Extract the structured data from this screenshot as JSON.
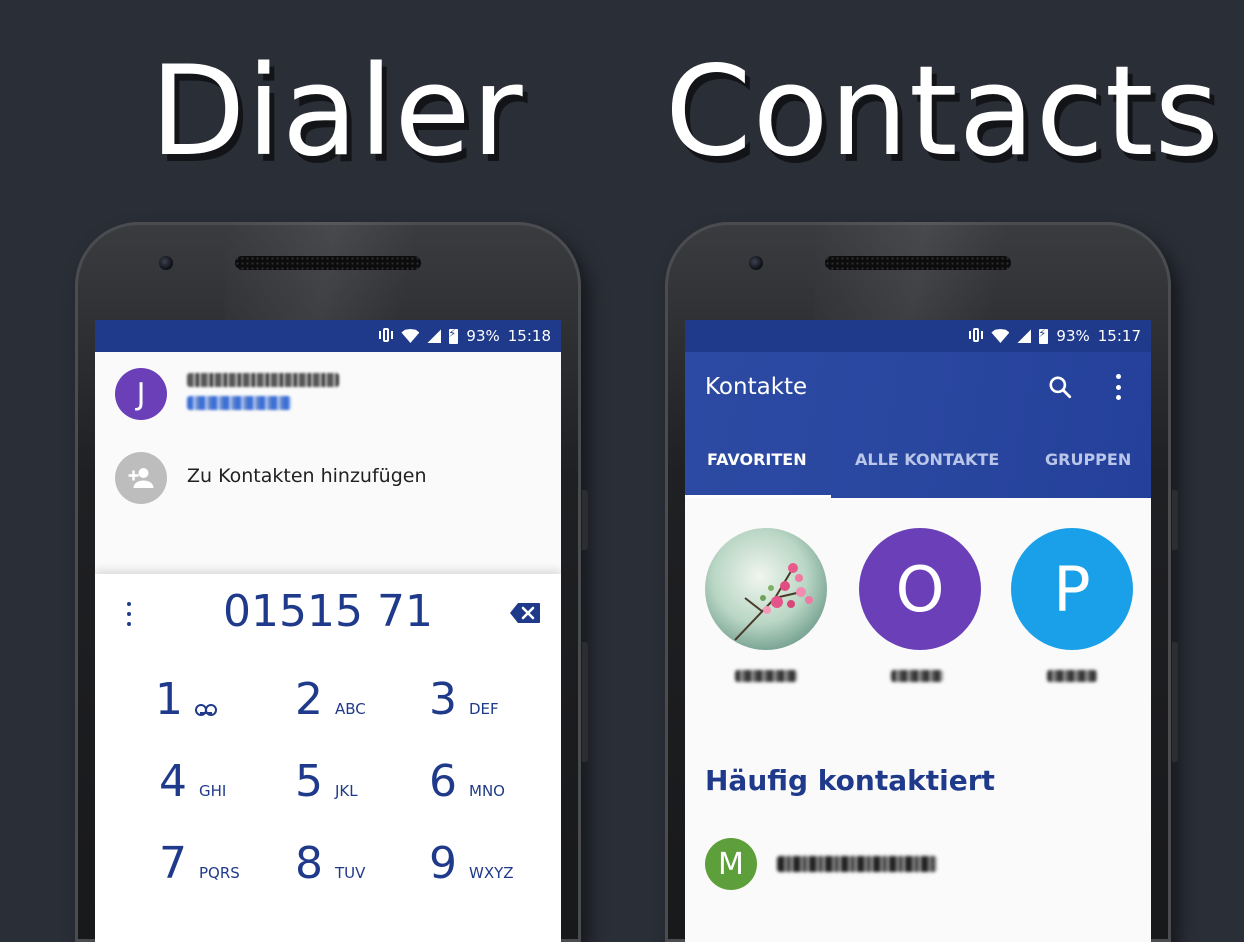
{
  "headlines": {
    "left": "Dialer",
    "right": "Contacts"
  },
  "dialer": {
    "status": {
      "battery": "93%",
      "time": "15:18"
    },
    "contact_initial": "J",
    "add_contact_label": "Zu Kontakten hinzufügen",
    "number": "01515 71",
    "keys": [
      {
        "digit": "1",
        "letters": ""
      },
      {
        "digit": "2",
        "letters": "ABC"
      },
      {
        "digit": "3",
        "letters": "DEF"
      },
      {
        "digit": "4",
        "letters": "GHI"
      },
      {
        "digit": "5",
        "letters": "JKL"
      },
      {
        "digit": "6",
        "letters": "MNO"
      },
      {
        "digit": "7",
        "letters": "PQRS"
      },
      {
        "digit": "8",
        "letters": "TUV"
      },
      {
        "digit": "9",
        "letters": "WXYZ"
      }
    ],
    "colors": {
      "accent": "#1f3a8a",
      "avatar_j": "#6a3fb8",
      "add_avatar": "#bdbdbd"
    }
  },
  "contacts": {
    "status": {
      "battery": "93%",
      "time": "15:17"
    },
    "title": "Kontakte",
    "tabs": [
      "FAVORITEN",
      "ALLE KONTAKTE",
      "GRUPPEN"
    ],
    "active_tab": "FAVORITEN",
    "favorites": [
      {
        "initial": "",
        "type": "photo"
      },
      {
        "initial": "O",
        "color": "#6a3fb8"
      },
      {
        "initial": "P",
        "color": "#1aa0e8"
      }
    ],
    "section_title": "Häufig kontaktiert",
    "frequent": [
      {
        "initial": "M",
        "color": "#5d9f3a"
      }
    ],
    "colors": {
      "appbar": "#2a47a0",
      "accent": "#1f3a8a"
    }
  }
}
